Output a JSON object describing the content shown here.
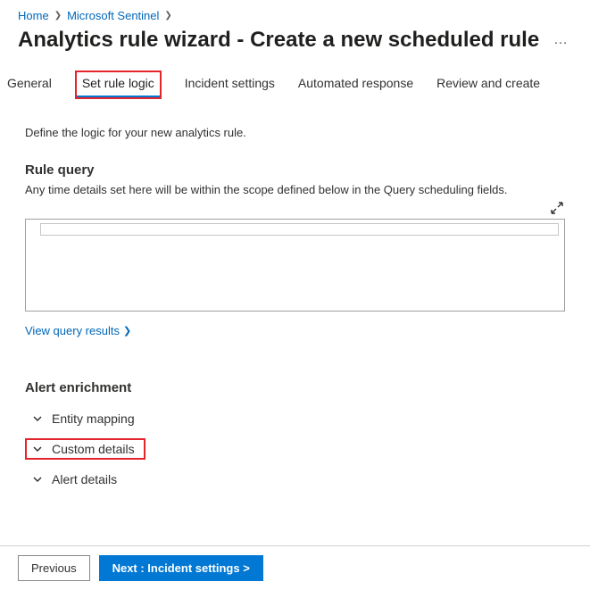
{
  "breadcrumb": {
    "home": "Home",
    "sentinel": "Microsoft Sentinel"
  },
  "page": {
    "title": "Analytics rule wizard - Create a new scheduled rule"
  },
  "tabs": {
    "general": "General",
    "set_rule_logic": "Set rule logic",
    "incident_settings": "Incident settings",
    "automated_response": "Automated response",
    "review_create": "Review and create"
  },
  "content": {
    "intro": "Define the logic for your new analytics rule.",
    "rule_query_heading": "Rule query",
    "rule_query_sub": "Any time details set here will be within the scope defined below in the Query scheduling fields.",
    "view_results": "View query results",
    "enrichment_heading": "Alert enrichment",
    "enrich_items": {
      "entity_mapping": "Entity mapping",
      "custom_details": "Custom details",
      "alert_details": "Alert details"
    }
  },
  "footer": {
    "previous": "Previous",
    "next": "Next : Incident settings >"
  }
}
